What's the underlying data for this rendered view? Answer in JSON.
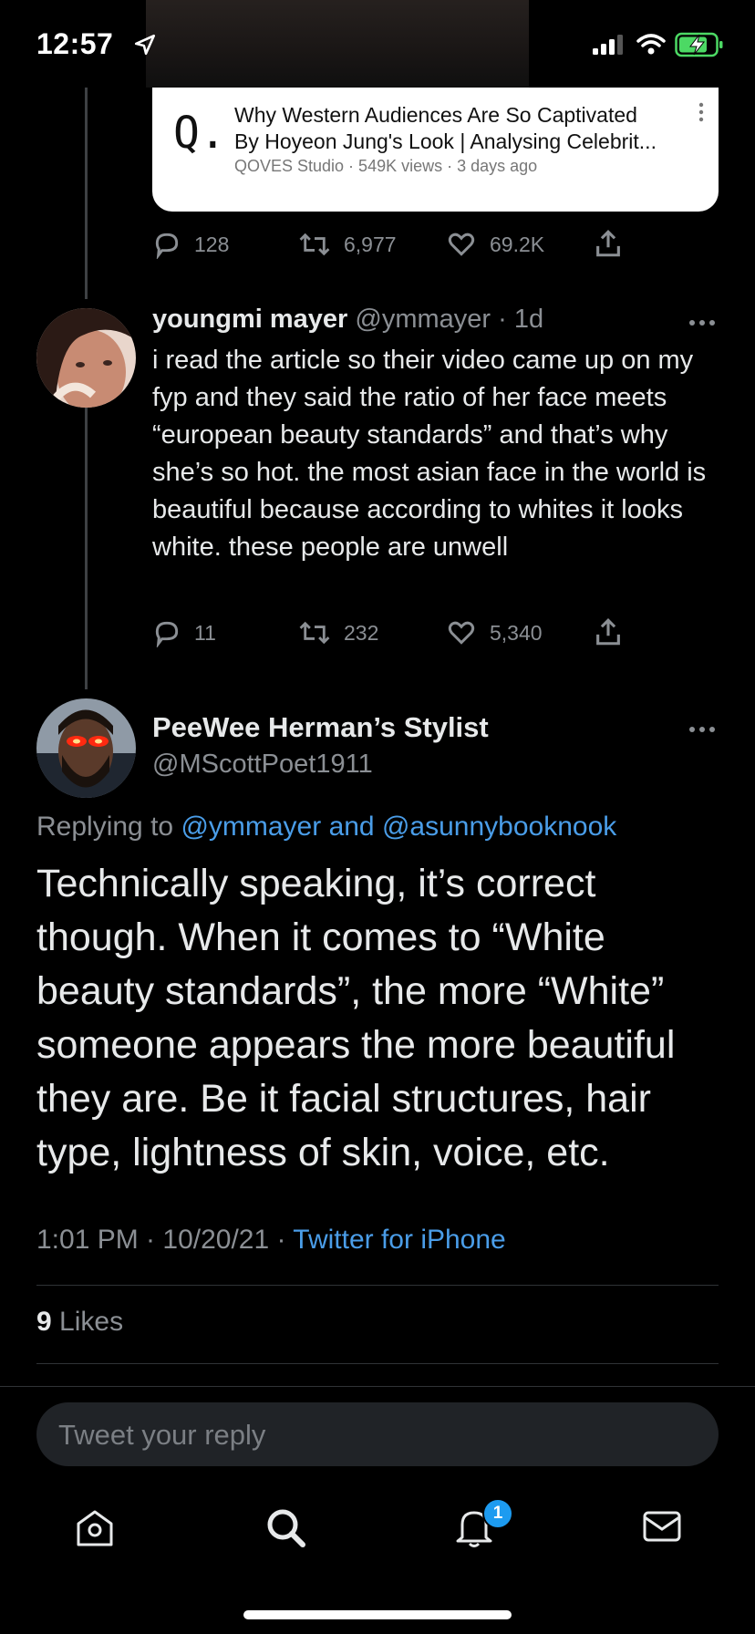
{
  "status_bar": {
    "time": "12:57"
  },
  "link_card": {
    "logo": "Q.",
    "title_line1": "Why Western Audiences Are So Captivated",
    "title_line2": "By Hoyeon Jung's Look | Analysing Celebrit...",
    "meta": "QOVES Studio · 549K views · 3 days ago"
  },
  "quoted_actions": {
    "replies": "128",
    "retweets": "6,977",
    "likes": "69.2K"
  },
  "reply_tweet": {
    "name": "youngmi mayer",
    "handle": "@ymmayer",
    "time": "· 1d",
    "text": "i read the article so their video came up on my fyp and they said the ratio of her face meets “european beauty standards” and that’s why she’s so hot. the most asian face in the world is beautiful because according to whites it looks white. these people are unwell",
    "replies": "11",
    "retweets": "232",
    "likes": "5,340"
  },
  "main_tweet": {
    "name": "PeeWee Herman’s Stylist",
    "handle": "@MScottPoet1911",
    "replying_prefix": "Replying to",
    "replying_handles": "@ymmayer and @asunnybooknook",
    "text": "Technically speaking, it’s correct though. When it comes to “White beauty standards”, the more “White” someone appears the more beautiful they are. Be it facial structures, hair type, lightness of skin, voice, etc.",
    "timestamp": "1:01 PM · 10/20/21 ·",
    "client": "Twitter for iPhone",
    "likes_count": "9",
    "likes_label": "Likes"
  },
  "reply_composer": {
    "placeholder": "Tweet your reply"
  },
  "tab_bar": {
    "notifications_badge": "1"
  },
  "icons": [
    "location-arrow-icon",
    "signal-icon",
    "wifi-icon",
    "battery-charging-icon",
    "reply-icon",
    "retweet-icon",
    "heart-icon",
    "share-icon",
    "more-icon",
    "home-icon",
    "search-icon",
    "bell-icon",
    "mail-icon"
  ],
  "colors": {
    "background": "#000000",
    "accent": "#1d9bf0",
    "link": "#4a9de8",
    "muted": "#8b8f94"
  }
}
